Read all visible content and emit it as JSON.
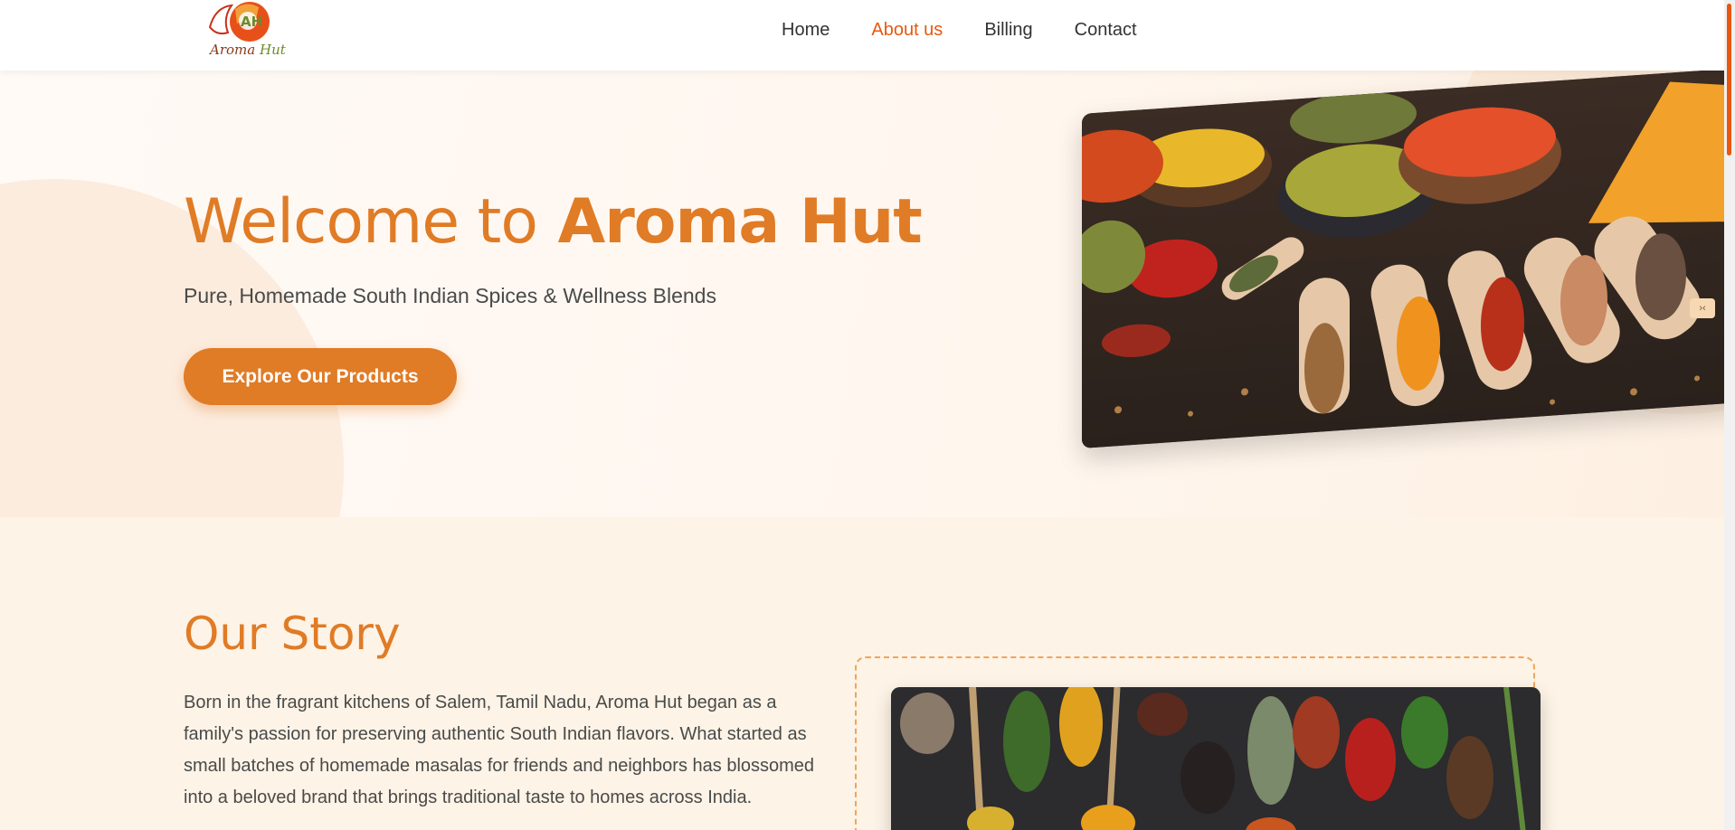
{
  "brand": {
    "logo_word_1": "Aroma",
    "logo_word_2": "Hut",
    "logo_monogram": "AH"
  },
  "nav": [
    {
      "label": "Home",
      "active": false
    },
    {
      "label": "About us",
      "active": true
    },
    {
      "label": "Billing",
      "active": false
    },
    {
      "label": "Contact",
      "active": false
    }
  ],
  "hero": {
    "title_part1": "Welcome to",
    "title_part2": "Aroma Hut",
    "subtitle": "Pure, Homemade South Indian Spices & Wellness Blends",
    "cta_label": "Explore Our Products",
    "image_icon": "spices-bowls-and-scoops-photo"
  },
  "story": {
    "title": "Our Story",
    "text": "Born in the fragrant kitchens of Salem, Tamil Nadu, Aroma Hut began as a family's passion for preserving authentic South Indian flavors. What started as small batches of homemade masalas for friends and neighbors has blossomed into a beloved brand that brings traditional taste to homes across India.",
    "image_icon": "spices-on-spoons-photo"
  },
  "colors": {
    "accent": "#e07b26",
    "nav_active": "#e8580f",
    "story_bg": "#fdf3e6"
  }
}
